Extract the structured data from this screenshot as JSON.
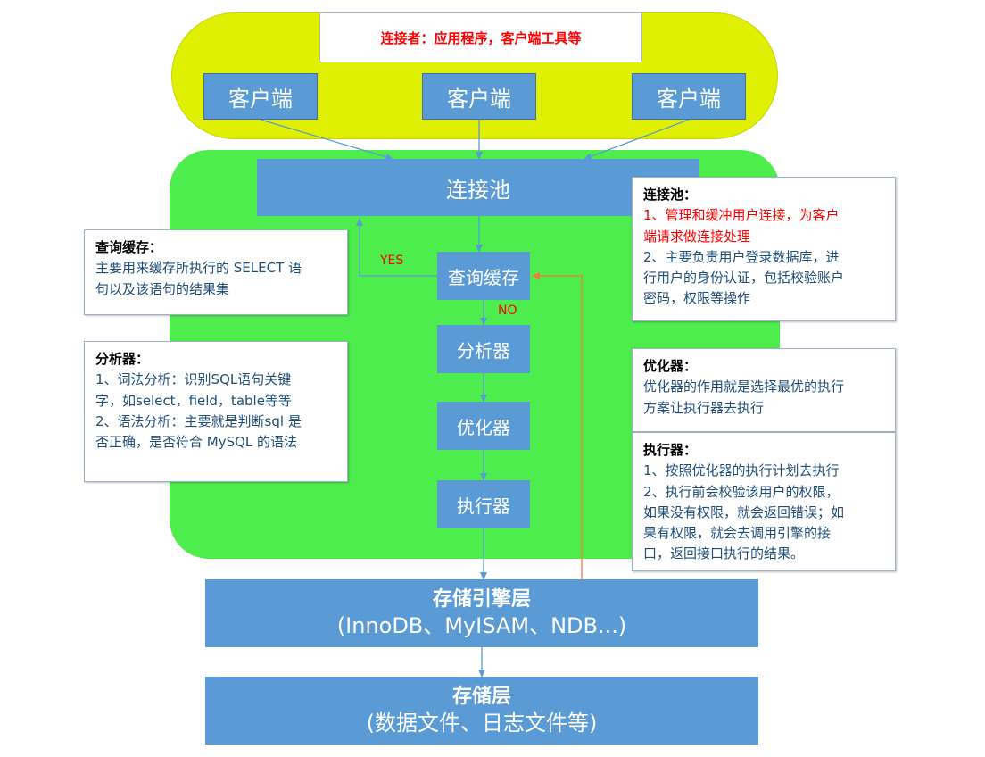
{
  "top_zone": {
    "header": "连接者：应用程序，客户端工具等",
    "clients": [
      "客户端",
      "客户端",
      "客户端"
    ]
  },
  "server_zone": {
    "pool": "连接池",
    "query_cache": "查询缓存",
    "parser": "分析器",
    "optimizer": "优化器",
    "executor": "执行器",
    "yes_label": "YES",
    "no_label": "NO"
  },
  "engine_layer": {
    "title": "存储引擎层",
    "subtitle": "(InnoDB、MyISAM、NDB...)"
  },
  "storage_layer": {
    "title": "存储层",
    "subtitle": "(数据文件、日志文件等)"
  },
  "notes": {
    "query_cache": {
      "title": "查询缓存：",
      "lines": [
        "主要用来缓存所执行的 SELECT 语",
        "句以及该语句的结果集"
      ]
    },
    "parser": {
      "title": "分析器：",
      "lines": [
        "1、词法分析：识别SQL语句关键",
        "字，如select，field，table等等",
        "2、语法分析：主要就是判断sql 是",
        "否正确，是否符合 MySQL 的语法"
      ]
    },
    "pool": {
      "title": "连接池：",
      "red_lines": [
        "1、管理和缓冲用户连接，为客户",
        "端请求做连接处理"
      ],
      "lines": [
        "2、主要负责用户登录数据库，进",
        "行用户的身份认证，包括校验账户",
        "密码，权限等操作"
      ]
    },
    "optimizer": {
      "title": "优化器：",
      "lines": [
        "优化器的作用就是选择最优的执行",
        "方案让执行器去执行"
      ]
    },
    "executor": {
      "title": "执行器：",
      "lines": [
        "1、按照优化器的执行计划去执行",
        "2、执行前会校验该用户的权限，",
        "如果没有权限，就会返回错误；如",
        "果有权限，就会去调用引擎的接",
        "口，返回接口执行的结果。"
      ]
    }
  },
  "colors": {
    "client_zone": "#dff000",
    "server_zone": "#4ded4d",
    "box": "#5b9bd5",
    "flow_arrow": "#5b9bd5",
    "return_arrow": "#f4793b",
    "highlight_text": "#ff0000"
  }
}
